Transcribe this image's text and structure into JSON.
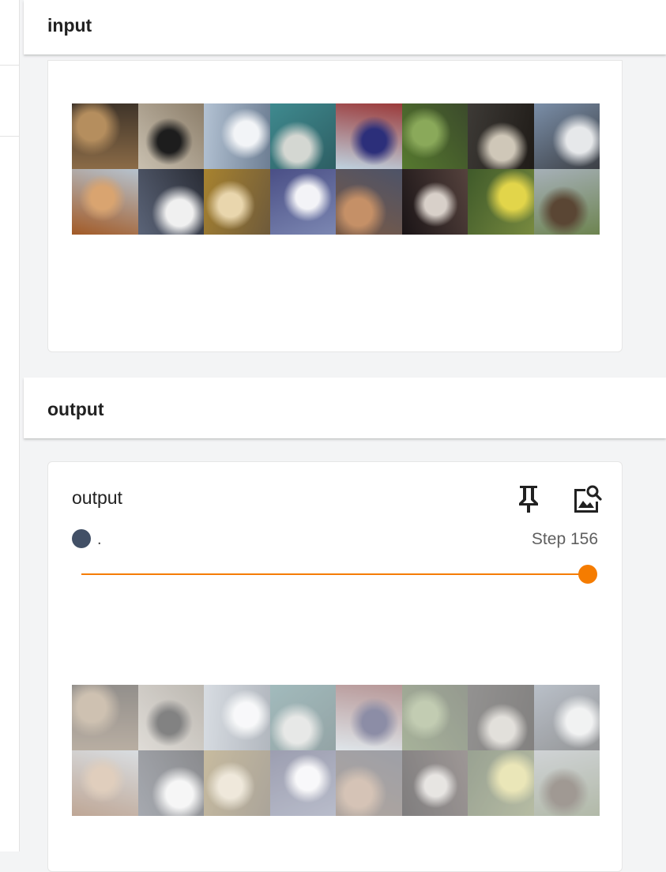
{
  "input_section": {
    "header_label": "input"
  },
  "output_section": {
    "header_label": "output",
    "card": {
      "title": "output",
      "pin_icon": "pin-icon",
      "view_image_icon": "image-search-icon",
      "run_name": ".",
      "step_label": "Step 156",
      "slider_fraction": 1.0,
      "images_faded": true
    }
  },
  "colors": {
    "accent": "#f57c00",
    "run_color": "#425066",
    "page_bg": "#f3f4f5",
    "card_bg": "#ffffff"
  },
  "image_tiles": [
    {
      "subject": "horse-rider",
      "colors": [
        "#8b6b47",
        "#b58e5e",
        "#3f3429"
      ]
    },
    {
      "subject": "dog",
      "colors": [
        "#c9c0b0",
        "#1d1d1d",
        "#8c7e6a"
      ]
    },
    {
      "subject": "boat",
      "colors": [
        "#b3c2d3",
        "#f2f4f7",
        "#6d7e93"
      ]
    },
    {
      "subject": "airplane",
      "colors": [
        "#3f8a8f",
        "#d4d7d2",
        "#2d5e63"
      ]
    },
    {
      "subject": "ship",
      "colors": [
        "#bfd3e0",
        "#2c2f7a",
        "#9b3a3a"
      ]
    },
    {
      "subject": "ostrich",
      "colors": [
        "#56792e",
        "#8aa95a",
        "#3b4a2b"
      ]
    },
    {
      "subject": "horse-head",
      "colors": [
        "#3d3a36",
        "#cfc7b8",
        "#1f1b17"
      ]
    },
    {
      "subject": "airplane",
      "colors": [
        "#7a8ea8",
        "#e6e8ea",
        "#3c3f44"
      ]
    },
    {
      "subject": "cat",
      "colors": [
        "#a25a26",
        "#d9a470",
        "#b6c3cf"
      ]
    },
    {
      "subject": "dog",
      "colors": [
        "#5b6478",
        "#f0f0f0",
        "#2a2d36"
      ]
    },
    {
      "subject": "cat",
      "colors": [
        "#a8832f",
        "#e9d6ad",
        "#6e5a3b"
      ]
    },
    {
      "subject": "bird",
      "colors": [
        "#4a4f86",
        "#f3f3f7",
        "#7c87b2"
      ]
    },
    {
      "subject": "dog",
      "colors": [
        "#7a5a45",
        "#c59067",
        "#4d5368"
      ]
    },
    {
      "subject": "dog",
      "colors": [
        "#1a1416",
        "#d8d0c9",
        "#55423d"
      ]
    },
    {
      "subject": "car",
      "colors": [
        "#3f5a2a",
        "#e2d54a",
        "#788a3f"
      ]
    },
    {
      "subject": "horse",
      "colors": [
        "#a6b0b8",
        "#5a4634",
        "#6d8450"
      ]
    }
  ]
}
